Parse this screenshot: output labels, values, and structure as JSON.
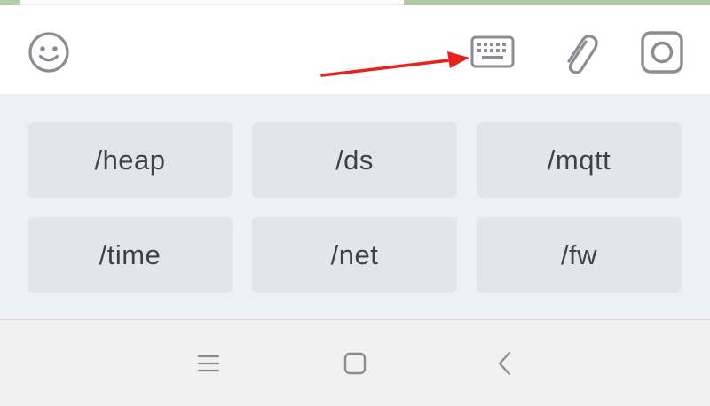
{
  "toolbar": {
    "icons": [
      "emoji-icon",
      "keyboard-icon",
      "paperclip-icon",
      "camera-icon"
    ]
  },
  "annotation": {
    "arrow_color": "#e8211d",
    "target": "keyboard-button"
  },
  "commands": {
    "rows": [
      [
        "/heap",
        "/ds",
        "/mqtt"
      ],
      [
        "/time",
        "/net",
        "/fw"
      ]
    ],
    "button_bg": "#e3e6e9",
    "panel_bg": "#eff0f3",
    "text_color": "#3e4248"
  },
  "navbar": {
    "icons": [
      "menu-icon",
      "home-icon",
      "back-icon"
    ]
  }
}
